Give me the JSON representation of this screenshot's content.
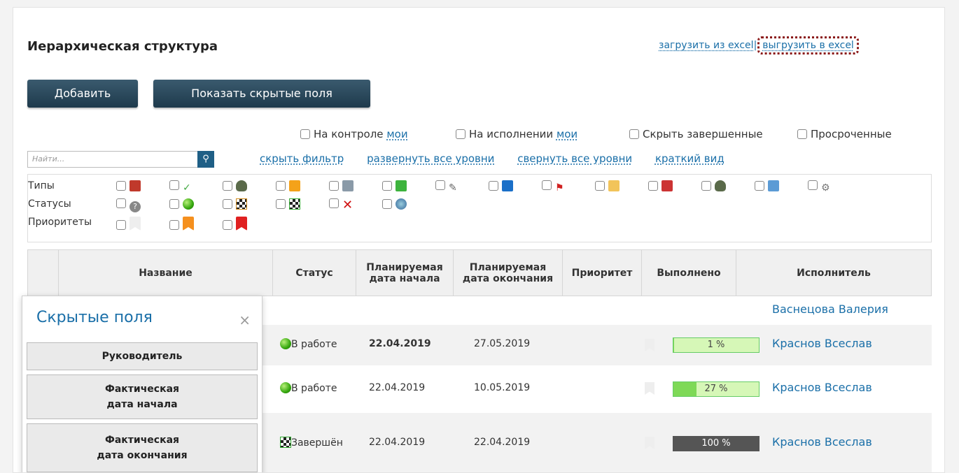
{
  "header": {
    "title": "Иерархическая структура",
    "import_link": "загрузить из excel",
    "separator": "|",
    "export_link": "выгрузить в excel"
  },
  "buttons": {
    "add": "Добавить",
    "show_hidden": "Показать скрытые поля"
  },
  "filters": {
    "on_control": "На контроле",
    "on_control_mine": "мои",
    "in_progress": "На исполнении",
    "in_progress_mine": "мои",
    "hide_completed": "Скрыть завершенные",
    "overdue": "Просроченные"
  },
  "search": {
    "placeholder": "Найти..."
  },
  "links": {
    "hide_filter": "скрыть фильтр",
    "expand_all": "развернуть все уровни",
    "collapse_all": "свернуть все уровни",
    "brief_view": "краткий вид"
  },
  "filter_box": {
    "types_label": "Типы",
    "statuses_label": "Статусы",
    "priorities_label": "Приоритеты",
    "type_icons": [
      "briefcase-icon",
      "checkmark-icon",
      "ufo-icon",
      "folder-orange-icon",
      "server-icon",
      "document-green-icon",
      "tool-icon",
      "folder-blue-icon",
      "flag-red-icon",
      "contact-folder-icon",
      "book-icon",
      "ufo-icon",
      "calendar-icon",
      "gears-icon"
    ],
    "status_icons": [
      "question-icon",
      "green-dot-icon",
      "question-flag-icon",
      "checkered-flag-icon",
      "red-cross-icon",
      "globe-icon"
    ],
    "priority_colors": [
      "#eeeeee",
      "#f5901e",
      "#e02020"
    ]
  },
  "table": {
    "columns": [
      "Название",
      "Статус",
      "Планируемая дата начала",
      "Планируемая дата окончания",
      "Приоритет",
      "Выполнено",
      "Исполнитель"
    ],
    "column_lines": {
      "plan_start": [
        "Планируемая",
        "дата начала"
      ],
      "plan_end": [
        "Планируемая",
        "дата окончания"
      ]
    },
    "rows": [
      {
        "status": "",
        "start": "",
        "end": "",
        "progress": null,
        "progress_label": "",
        "assignee": "Васнецова Валерия"
      },
      {
        "status": "В работе",
        "start": "22.04.2019",
        "end": "27.05.2019",
        "progress": 1,
        "progress_label": "1 %",
        "assignee": "Краснов Всеслав"
      },
      {
        "status": "В работе",
        "start": "22.04.2019",
        "end": "10.05.2019",
        "progress": 27,
        "progress_label": "27 %",
        "assignee": "Краснов Всеслав"
      },
      {
        "status": "Завершён",
        "start": "22.04.2019",
        "end": "22.04.2019",
        "progress": 100,
        "progress_label": "100 %",
        "assignee": "Краснов Всеслав"
      }
    ]
  },
  "hidden_fields_popup": {
    "title": "Скрытые поля",
    "close": "×",
    "items": [
      {
        "line1": "Руководитель",
        "line2": ""
      },
      {
        "line1": "Фактическая",
        "line2": "дата начала"
      },
      {
        "line1": "Фактическая",
        "line2": "дата окончания"
      }
    ]
  }
}
